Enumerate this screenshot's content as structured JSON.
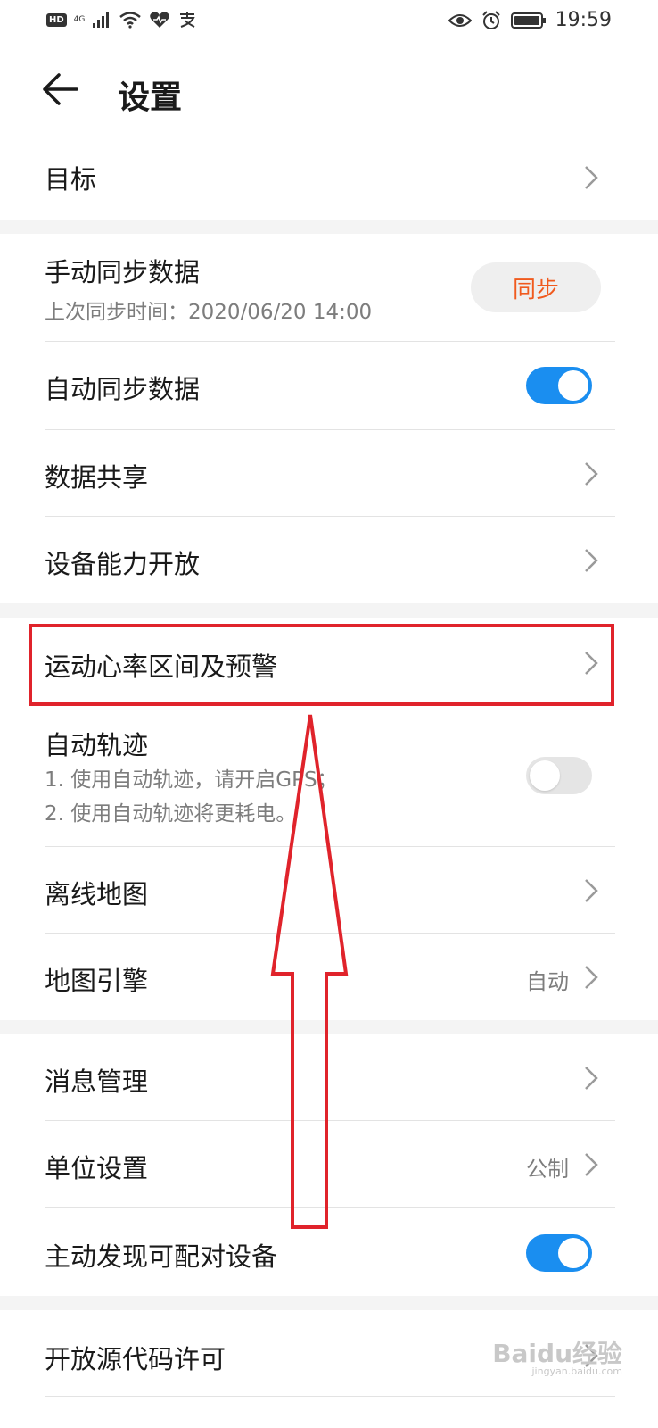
{
  "status_bar": {
    "hd": "HD",
    "network": "4G",
    "time": "19:59"
  },
  "header": {
    "title": "设置"
  },
  "rows": {
    "goal": {
      "label": "目标"
    },
    "manual_sync": {
      "label": "手动同步数据",
      "subtitle": "上次同步时间：2020/06/20 14:00",
      "button": "同步"
    },
    "auto_sync": {
      "label": "自动同步数据",
      "on": true
    },
    "data_sharing": {
      "label": "数据共享"
    },
    "device_capability": {
      "label": "设备能力开放"
    },
    "heart_rate_zone": {
      "label": "运动心率区间及预警"
    },
    "auto_track": {
      "label": "自动轨迹",
      "note1": "1. 使用自动轨迹，请开启GPS；",
      "note2": "2. 使用自动轨迹将更耗电。",
      "on": false
    },
    "offline_map": {
      "label": "离线地图"
    },
    "map_engine": {
      "label": "地图引擎",
      "value": "自动"
    },
    "message_management": {
      "label": "消息管理"
    },
    "unit_settings": {
      "label": "单位设置",
      "value": "公制"
    },
    "discover_devices": {
      "label": "主动发现可配对设备",
      "on": true
    },
    "open_source": {
      "label": "开放源代码许可"
    }
  },
  "watermark": {
    "text": "Baidu经验",
    "sub": "jingyan.baidu.com"
  },
  "colors": {
    "accent_blue": "#1a8ef0",
    "sync_orange": "#f05a1e",
    "annotation_red": "#e0232b"
  }
}
